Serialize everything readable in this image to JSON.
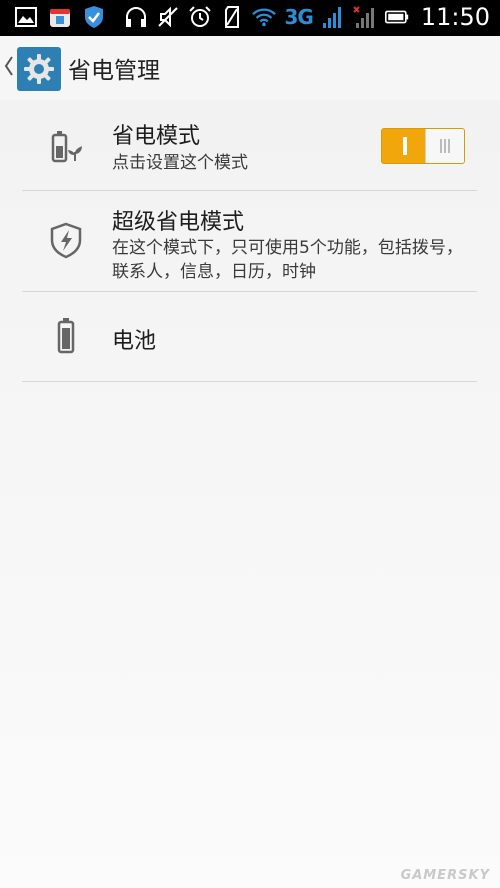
{
  "status_bar": {
    "network": "3G",
    "time": "11:50"
  },
  "app_bar": {
    "title": "省电管理"
  },
  "items": [
    {
      "title": "省电模式",
      "subtitle": "点击设置这个模式",
      "icon": "battery-leaf-icon",
      "toggle": "on"
    },
    {
      "title": "超级省电模式",
      "subtitle": "在这个模式下，只可使用5个功能，包括拨号，联系人，信息，日历，时钟",
      "icon": "shield-bolt-icon"
    },
    {
      "title": "电池",
      "icon": "battery-icon"
    }
  ],
  "watermark": "GAMERSKY",
  "colors": {
    "accent": "#f1a60c",
    "app_icon": "#2e7fb4",
    "network": "#2a8fd8"
  }
}
